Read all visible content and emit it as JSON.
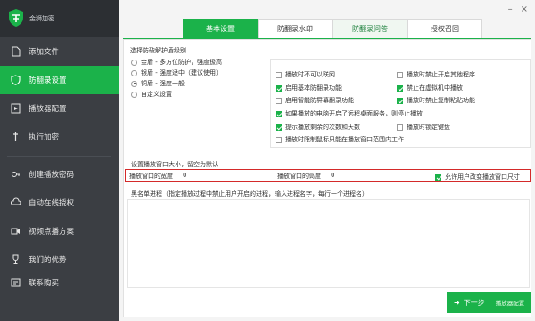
{
  "app": {
    "name": "金狮加密",
    "colors": {
      "accent": "#1bb24a",
      "sidebar": "#3b3e43",
      "alert": "#d42a2a"
    }
  },
  "window_controls": {
    "minimize": "–",
    "close": "×"
  },
  "sidebar": {
    "items": [
      {
        "label": "添加文件",
        "icon": "file-add-icon"
      },
      {
        "label": "防翻录设置",
        "icon": "shield-icon",
        "active": true
      },
      {
        "label": "播放器配置",
        "icon": "player-icon"
      },
      {
        "label": "执行加密",
        "icon": "lock-icon"
      },
      {
        "label": "创建播放密码",
        "icon": "key-icon"
      },
      {
        "label": "自动在线授权",
        "icon": "cloud-icon"
      },
      {
        "label": "视频点播方案",
        "icon": "video-icon"
      },
      {
        "label": "我们的优势",
        "icon": "trophy-icon"
      },
      {
        "label": "联系购买",
        "icon": "contact-icon"
      }
    ]
  },
  "tabs": [
    {
      "label": "基本设置",
      "active": true
    },
    {
      "label": "防翻录水印"
    },
    {
      "label": "防翻录问答"
    },
    {
      "label": "授权召回"
    }
  ],
  "protection_level": {
    "title": "选择防破解护盾级别",
    "options": [
      {
        "label": "金盾 - 多方位防护，强度极高",
        "selected": false
      },
      {
        "label": "银盾 - 强度适中（建议使用）",
        "selected": false
      },
      {
        "label": "铜盾 - 强度一般",
        "selected": true
      },
      {
        "label": "自定义设置",
        "selected": false
      }
    ]
  },
  "options": {
    "left": [
      {
        "label": "播放时不可以联网",
        "checked": false
      },
      {
        "label": "启用基本防翻录功能",
        "checked": true
      },
      {
        "label": "启用智能防屏幕翻录功能",
        "checked": false
      }
    ],
    "right": [
      {
        "label": "播放时禁止开启其他程序",
        "checked": false
      },
      {
        "label": "禁止在虚拟机中播放",
        "checked": true
      },
      {
        "label": "播放时禁止复制粘贴功能",
        "checked": true
      }
    ],
    "wide": [
      {
        "label": "如果播放的电脑开启了远程桌面服务，则停止播放",
        "checked": true
      },
      {
        "label": "提示播放剩余的次数和天数",
        "checked": true
      }
    ],
    "right_extra": {
      "label": "播放时锁定键盘",
      "checked": false
    },
    "last": {
      "label": "播放时限制鼠标只能在播放窗口范围内工作",
      "checked": false
    }
  },
  "window_size": {
    "title": "设置播放窗口大小，留空为默认",
    "width_label": "播放窗口的宽度",
    "width_value": "0",
    "height_label": "播放窗口的高度",
    "height_value": "0",
    "allow_resize": {
      "label": "允许用户改变播放窗口尺寸",
      "checked": true
    }
  },
  "blacklist": {
    "title": "黑名单进程（指定播放过程中禁止用户开启的进程，输入进程名字，每行一个进程名）",
    "value": ""
  },
  "next_button": {
    "arrow": "➜",
    "label": "下一步",
    "sublabel": "播放器配置"
  }
}
